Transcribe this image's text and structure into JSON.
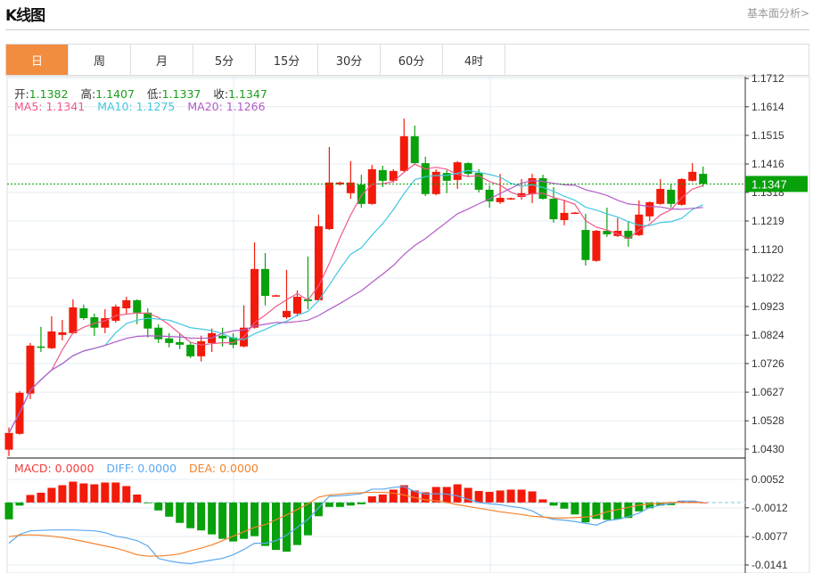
{
  "header": {
    "title": "K线图",
    "fundamental_link": "基本面分析>"
  },
  "tabs": [
    {
      "label": "日",
      "active": true
    },
    {
      "label": "周"
    },
    {
      "label": "月"
    },
    {
      "label": "5分"
    },
    {
      "label": "15分"
    },
    {
      "label": "30分"
    },
    {
      "label": "60分"
    },
    {
      "label": "4时"
    }
  ],
  "ohlc_info": {
    "open_label": "开:",
    "open": "1.1382",
    "high_label": "高:",
    "high": "1.1407",
    "low_label": "低:",
    "low": "1.1337",
    "close_label": "收:",
    "close": "1.1347"
  },
  "ma_info": {
    "ma5": "MA5: 1.1341",
    "ma10": "MA10: 1.1275",
    "ma20": "MA20: 1.1266"
  },
  "macd_info": {
    "macd": "MACD: 0.0000",
    "diff": "DIFF: 0.0000",
    "dea": "DEA: 0.0000"
  },
  "colors": {
    "up": "#f21a0a",
    "down": "#08a10c",
    "ma5": "#f0588a",
    "ma10": "#40c8e0",
    "ma20": "#b45cc8",
    "diff": "#5aa8f0",
    "dea": "#f5822a",
    "accent_tab": "#f28c3f"
  },
  "chart_data": {
    "type": "candlestick",
    "price_axis": {
      "ticks": [
        "1.1712",
        "1.1614",
        "1.1515",
        "1.1416",
        "1.1318",
        "1.1219",
        "1.1120",
        "1.1022",
        "1.0923",
        "1.0824",
        "1.0726",
        "1.0627",
        "1.0528",
        "1.0430"
      ],
      "range": [
        1.043,
        1.1712
      ]
    },
    "current_price": "1.1347",
    "ohlc": [
      [
        1.0428,
        1.0505,
        1.0406,
        1.0486
      ],
      [
        1.0483,
        1.0631,
        1.048,
        1.0625
      ],
      [
        1.0622,
        1.0797,
        1.0603,
        1.0788
      ],
      [
        1.0785,
        1.0853,
        1.0766,
        1.0782
      ],
      [
        1.0779,
        1.0889,
        1.0776,
        1.0837
      ],
      [
        1.0825,
        1.0877,
        1.0806,
        1.0834
      ],
      [
        1.0831,
        1.0948,
        1.0828,
        1.092
      ],
      [
        1.0917,
        1.093,
        1.0877,
        1.0883
      ],
      [
        1.0886,
        1.0899,
        1.0822,
        1.085
      ],
      [
        1.085,
        1.0914,
        1.0831,
        1.0883
      ],
      [
        1.0874,
        1.093,
        1.0868,
        1.0923
      ],
      [
        1.0917,
        1.0957,
        1.0896,
        1.0945
      ],
      [
        1.0945,
        1.0948,
        1.0862,
        1.0902
      ],
      [
        1.0902,
        1.0917,
        1.0816,
        1.0847
      ],
      [
        1.085,
        1.0862,
        1.0797,
        1.081
      ],
      [
        1.0813,
        1.0831,
        1.0782,
        1.0797
      ],
      [
        1.08,
        1.0828,
        1.0776,
        1.0791
      ],
      [
        1.0791,
        1.08,
        1.0745,
        1.0751
      ],
      [
        1.0751,
        1.0822,
        1.0733,
        1.0803
      ],
      [
        1.0797,
        1.0847,
        1.0766,
        1.0831
      ],
      [
        1.0822,
        1.085,
        1.0785,
        1.0813
      ],
      [
        1.0816,
        1.0831,
        1.0779,
        1.0791
      ],
      [
        1.0785,
        1.0927,
        1.0782,
        1.085
      ],
      [
        1.085,
        1.1145,
        1.0847,
        1.1053
      ],
      [
        1.1053,
        1.1108,
        1.0927,
        1.096
      ],
      [
        1.0959,
        1.0964,
        1.0957,
        1.0962
      ],
      [
        1.0886,
        1.105,
        1.088,
        1.0908
      ],
      [
        1.0899,
        1.0979,
        1.0889,
        1.0957
      ],
      [
        1.0948,
        1.1096,
        1.0914,
        1.0942
      ],
      [
        1.0945,
        1.1241,
        1.0942,
        1.1201
      ],
      [
        1.1191,
        1.1475,
        1.1188,
        1.1352
      ],
      [
        1.1345,
        1.1355,
        1.1342,
        1.1352
      ],
      [
        1.1315,
        1.1426,
        1.1296,
        1.1352
      ],
      [
        1.1345,
        1.1379,
        1.1265,
        1.1278
      ],
      [
        1.1278,
        1.1413,
        1.1275,
        1.1398
      ],
      [
        1.1395,
        1.141,
        1.1336,
        1.1358
      ],
      [
        1.1358,
        1.1398,
        1.1352,
        1.1392
      ],
      [
        1.1392,
        1.1573,
        1.1389,
        1.1512
      ],
      [
        1.1512,
        1.1549,
        1.1413,
        1.1419
      ],
      [
        1.1419,
        1.1441,
        1.1305,
        1.1312
      ],
      [
        1.1312,
        1.1398,
        1.1308,
        1.1389
      ],
      [
        1.1385,
        1.1395,
        1.1315,
        1.1358
      ],
      [
        1.1361,
        1.1426,
        1.133,
        1.1422
      ],
      [
        1.1419,
        1.1422,
        1.1373,
        1.1382
      ],
      [
        1.1385,
        1.1398,
        1.1318,
        1.1327
      ],
      [
        1.1327,
        1.1342,
        1.1265,
        1.1287
      ],
      [
        1.1284,
        1.1382,
        1.1278,
        1.1299
      ],
      [
        1.1295,
        1.13,
        1.1292,
        1.1298
      ],
      [
        1.1302,
        1.1364,
        1.1293,
        1.1315
      ],
      [
        1.1312,
        1.1382,
        1.1281,
        1.1367
      ],
      [
        1.1367,
        1.1379,
        1.1293,
        1.1296
      ],
      [
        1.1296,
        1.1336,
        1.1213,
        1.1225
      ],
      [
        1.1222,
        1.1293,
        1.1204,
        1.1247
      ],
      [
        1.1245,
        1.125,
        1.1243,
        1.1248
      ],
      [
        1.1188,
        1.1244,
        1.1065,
        1.1084
      ],
      [
        1.1081,
        1.1188,
        1.1078,
        1.1185
      ],
      [
        1.1185,
        1.1265,
        1.1164,
        1.1173
      ],
      [
        1.1167,
        1.1229,
        1.1164,
        1.1185
      ],
      [
        1.1185,
        1.1219,
        1.113,
        1.1158
      ],
      [
        1.117,
        1.129,
        1.1167,
        1.1241
      ],
      [
        1.1235,
        1.1287,
        1.1219,
        1.1284
      ],
      [
        1.1278,
        1.1364,
        1.1275,
        1.133
      ],
      [
        1.1327,
        1.1345,
        1.1265,
        1.1278
      ],
      [
        1.1275,
        1.1367,
        1.1272,
        1.1364
      ],
      [
        1.1358,
        1.1419,
        1.1355,
        1.1389
      ],
      [
        1.1382,
        1.1407,
        1.1337,
        1.1347
      ]
    ],
    "macd_axis": {
      "ticks": [
        "0.0052",
        "-0.0012",
        "-0.0077",
        "-0.0141"
      ],
      "range": [
        -0.0141,
        0.0052
      ]
    },
    "macd_hist": [
      -0.0038,
      -0.0007,
      0.0017,
      0.0022,
      0.0033,
      0.0039,
      0.0047,
      0.0043,
      0.0041,
      0.0045,
      0.0045,
      0.0037,
      0.0018,
      -0.0001,
      -0.0018,
      -0.0032,
      -0.0046,
      -0.0058,
      -0.0063,
      -0.0072,
      -0.0082,
      -0.0088,
      -0.0082,
      -0.0076,
      -0.0098,
      -0.0107,
      -0.0111,
      -0.0096,
      -0.0074,
      -0.0031,
      -0.001,
      -0.001,
      -0.0007,
      -0.0004,
      0.0014,
      0.0018,
      0.0029,
      0.0039,
      0.0027,
      0.0023,
      0.0035,
      0.0035,
      0.0041,
      0.0033,
      0.0026,
      0.0024,
      0.0027,
      0.0029,
      0.0029,
      0.0025,
      0.0007,
      -0.0007,
      -0.0014,
      -0.0027,
      -0.0045,
      -0.0037,
      -0.0039,
      -0.0038,
      -0.0035,
      -0.002,
      -0.0013,
      -0.0007,
      -0.0006,
      0.0004,
      0.0004,
      0.0
    ],
    "diff": [
      -0.0092,
      -0.0072,
      -0.0064,
      -0.0063,
      -0.0062,
      -0.0062,
      -0.0062,
      -0.0063,
      -0.0064,
      -0.0068,
      -0.0076,
      -0.008,
      -0.0086,
      -0.0098,
      -0.0126,
      -0.0132,
      -0.0136,
      -0.0138,
      -0.0134,
      -0.013,
      -0.0126,
      -0.0118,
      -0.0106,
      -0.0092,
      -0.0092,
      -0.0086,
      -0.0074,
      -0.0056,
      -0.0038,
      -0.0012,
      0.0014,
      0.0015,
      0.0017,
      0.002,
      0.003,
      0.003,
      0.0034,
      0.0036,
      0.0025,
      0.0019,
      0.002,
      0.0019,
      0.0015,
      0.0007,
      0.0,
      -0.0003,
      -0.0005,
      -0.0009,
      -0.0012,
      -0.0019,
      -0.0032,
      -0.0038,
      -0.004,
      -0.0043,
      -0.0047,
      -0.0051,
      -0.0041,
      -0.0038,
      -0.0032,
      -0.0024,
      -0.0011,
      -0.0006,
      -0.0002,
      0.0003,
      0.0003,
      0.0
    ],
    "dea": [
      -0.0077,
      -0.0074,
      -0.0073,
      -0.0074,
      -0.0076,
      -0.0079,
      -0.0083,
      -0.0088,
      -0.0093,
      -0.0098,
      -0.0103,
      -0.011,
      -0.0118,
      -0.0121,
      -0.0121,
      -0.0119,
      -0.0116,
      -0.0109,
      -0.0103,
      -0.0096,
      -0.0086,
      -0.0076,
      -0.0066,
      -0.0056,
      -0.005,
      -0.0039,
      -0.0028,
      -0.0016,
      -0.0003,
      0.0012,
      0.0017,
      0.0019,
      0.0021,
      0.0022,
      0.0023,
      0.0023,
      0.0021,
      0.0017,
      0.0011,
      0.0006,
      0.0004,
      0.0,
      -0.0005,
      -0.0009,
      -0.0013,
      -0.0017,
      -0.0021,
      -0.0024,
      -0.0027,
      -0.0031,
      -0.0033,
      -0.0035,
      -0.0035,
      -0.0034,
      -0.0033,
      -0.0029,
      -0.0021,
      -0.0016,
      -0.0011,
      -0.0006,
      -0.0003,
      -0.0002,
      0.0,
      0.0,
      0.0,
      0.0
    ],
    "grid": true
  }
}
